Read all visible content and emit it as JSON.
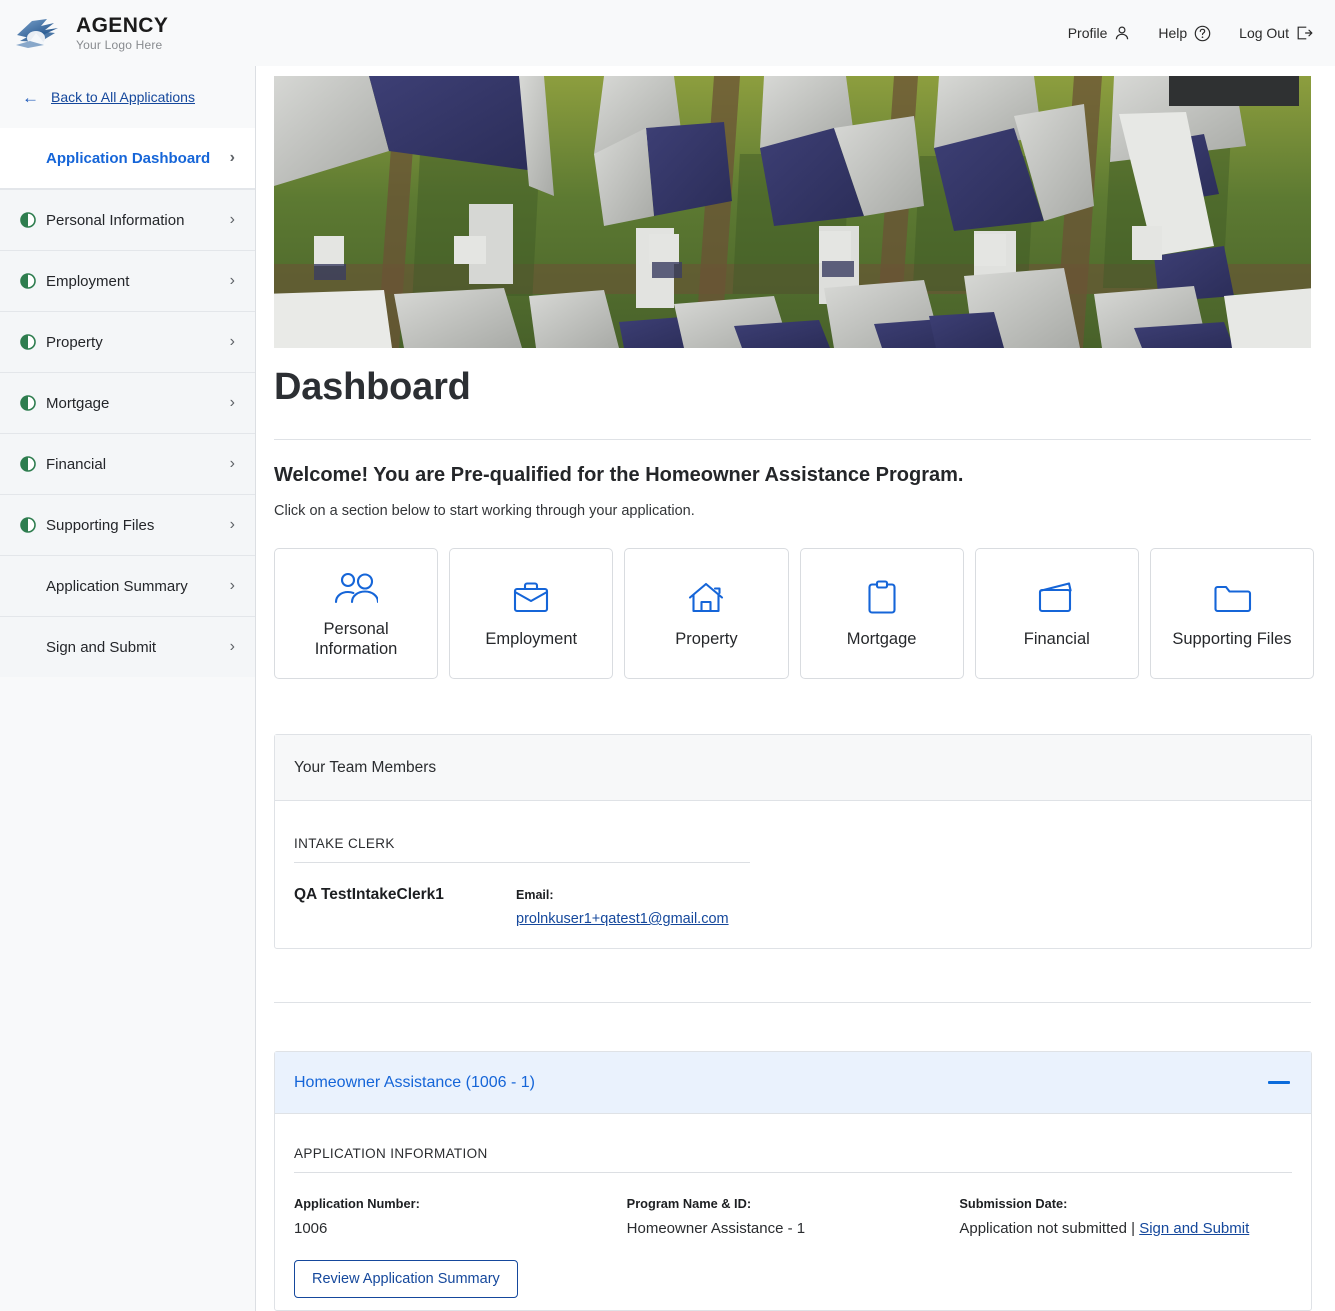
{
  "brand": {
    "title": "AGENCY",
    "tagline": "Your Logo Here",
    "logo_icon": "eagle-swoosh-logo",
    "accent_color": "#1565d8",
    "link_color": "#15489c",
    "status_color": "#2e7d4f"
  },
  "topnav": [
    {
      "label": "Profile",
      "icon": "user-icon"
    },
    {
      "label": "Help",
      "icon": "question-circle-icon"
    },
    {
      "label": "Log Out",
      "icon": "logout-icon"
    }
  ],
  "sidebar": {
    "back_link": "Back to All Applications",
    "back_icon": "arrow-left-icon",
    "items": [
      {
        "label": "Application Dashboard",
        "active": true,
        "has_status": false
      },
      {
        "label": "Personal Information",
        "active": false,
        "has_status": true
      },
      {
        "label": "Employment",
        "active": false,
        "has_status": true
      },
      {
        "label": "Property",
        "active": false,
        "has_status": true
      },
      {
        "label": "Mortgage",
        "active": false,
        "has_status": true
      },
      {
        "label": "Financial",
        "active": false,
        "has_status": true
      },
      {
        "label": "Supporting Files",
        "active": false,
        "has_status": true
      },
      {
        "label": "Application Summary",
        "active": false,
        "has_status": false
      },
      {
        "label": "Sign and Submit",
        "active": false,
        "has_status": false
      }
    ]
  },
  "main": {
    "hero_alt": "aerial-photo-of-suburban-neighborhood",
    "page_title": "Dashboard",
    "welcome_heading": "Welcome! You are Pre-qualified for the Homeowner Assistance Program.",
    "welcome_subtext": "Click on a section below to start working through your application.",
    "section_cards": [
      {
        "label": "Personal Information",
        "icon": "people-group-icon"
      },
      {
        "label": "Employment",
        "icon": "briefcase-icon"
      },
      {
        "label": "Property",
        "icon": "house-icon"
      },
      {
        "label": "Mortgage",
        "icon": "clipboard-icon"
      },
      {
        "label": "Financial",
        "icon": "wallet-icon"
      },
      {
        "label": "Supporting Files",
        "icon": "folder-icon"
      }
    ],
    "team": {
      "header": "Your Team Members",
      "role": "INTAKE CLERK",
      "name": "QA TestIntakeClerk1",
      "email_label": "Email:",
      "email": "prolnkuser1+qatest1@gmail.com"
    },
    "accordion": {
      "title": "Homeowner Assistance (1006 - 1)",
      "toggle_icon": "minus-icon",
      "section_title": "APPLICATION INFORMATION",
      "fields": [
        {
          "label": "Application Number:",
          "value": "1006"
        },
        {
          "label": "Program Name & ID:",
          "value": "Homeowner Assistance - 1"
        },
        {
          "label": "Submission Date:",
          "value": "Application not submitted | ",
          "link": "Sign and Submit"
        }
      ],
      "review_button": "Review Application Summary"
    }
  }
}
